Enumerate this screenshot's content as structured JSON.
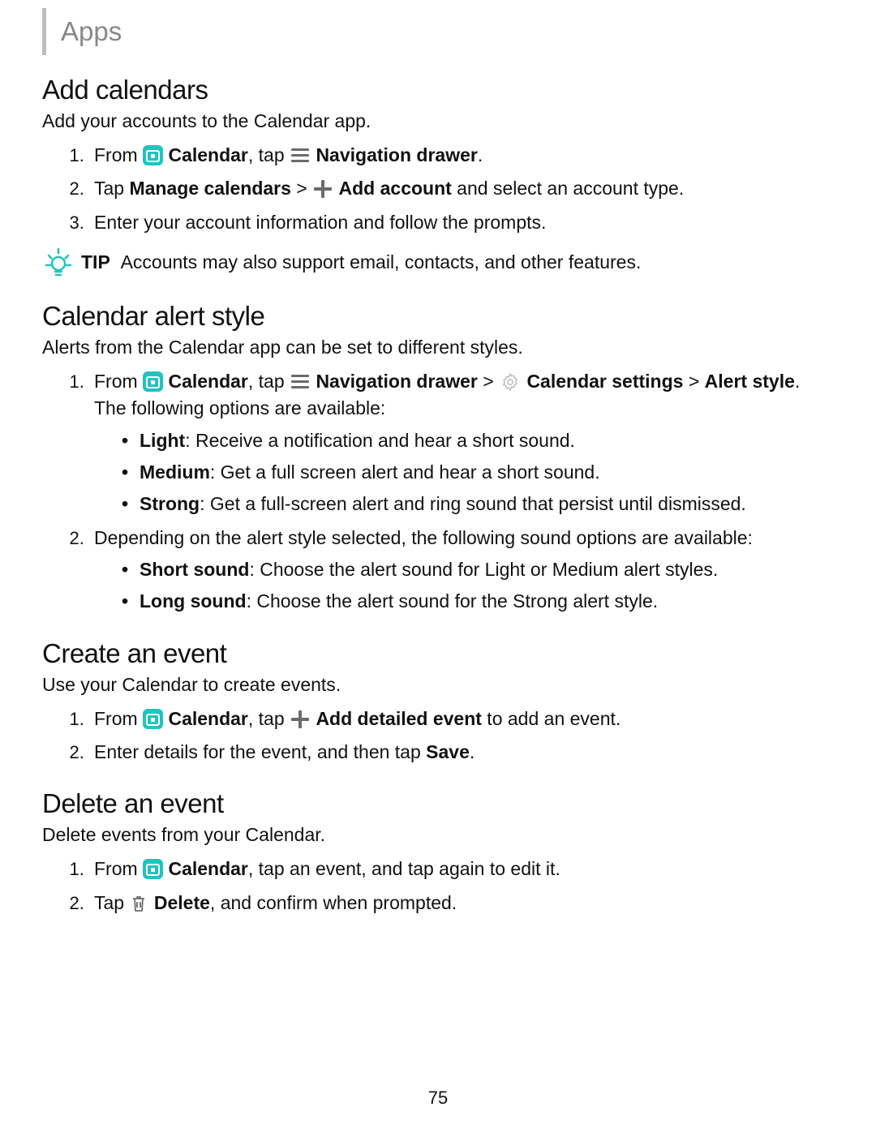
{
  "header": "Apps",
  "page_number": "75",
  "tip_label": "TIP",
  "sections": {
    "addcal": {
      "title": "Add calendars",
      "lead": "Add your accounts to the Calendar app.",
      "steps": {
        "s1": {
          "pre": "From ",
          "cal": "Calendar",
          "mid": ", tap ",
          "nav": "Navigation drawer",
          "post": "."
        },
        "s2": {
          "pre": "Tap ",
          "mc": "Manage calendars",
          "gt": " > ",
          "add": "Add account",
          "post": " and select an account type."
        },
        "s3": "Enter your account information and follow the prompts."
      },
      "tip": "Accounts may also support email, contacts, and other features."
    },
    "alert": {
      "title": "Calendar alert style",
      "lead": "Alerts from the Calendar app can be set to different styles.",
      "steps": {
        "s1": {
          "pre": "From ",
          "cal": "Calendar",
          "mid": ", tap ",
          "nav": "Navigation drawer",
          "gt": " > ",
          "cs": "Calendar settings",
          "gt2": " > ",
          "as": "Alert style",
          "post": ". The following options are available:"
        },
        "sub1": [
          {
            "k": "Light",
            "v": ": Receive a notification and hear a short sound."
          },
          {
            "k": "Medium",
            "v": ": Get a full screen alert and hear a short sound."
          },
          {
            "k": "Strong",
            "v": ": Get a full-screen alert and ring sound that persist until dismissed."
          }
        ],
        "s2": "Depending on the alert style selected, the following sound options are available:",
        "sub2": [
          {
            "k": "Short sound",
            "v": ": Choose the alert sound for Light or Medium alert styles."
          },
          {
            "k": "Long sound",
            "v": ": Choose the alert sound for the Strong alert style."
          }
        ]
      }
    },
    "create": {
      "title": "Create an event",
      "lead": "Use your Calendar to create events.",
      "steps": {
        "s1": {
          "pre": "From ",
          "cal": "Calendar",
          "mid": ", tap ",
          "add": "Add detailed event",
          "post": " to add an event."
        },
        "s2": {
          "pre": "Enter details for the event, and then tap ",
          "save": "Save",
          "post": "."
        }
      }
    },
    "delete": {
      "title": "Delete an event",
      "lead": "Delete events from your Calendar.",
      "steps": {
        "s1": {
          "pre": "From ",
          "cal": "Calendar",
          "post": ", tap an event, and tap again to edit it."
        },
        "s2": {
          "pre": "Tap ",
          "del": "Delete",
          "post": ", and confirm when prompted."
        }
      }
    }
  }
}
